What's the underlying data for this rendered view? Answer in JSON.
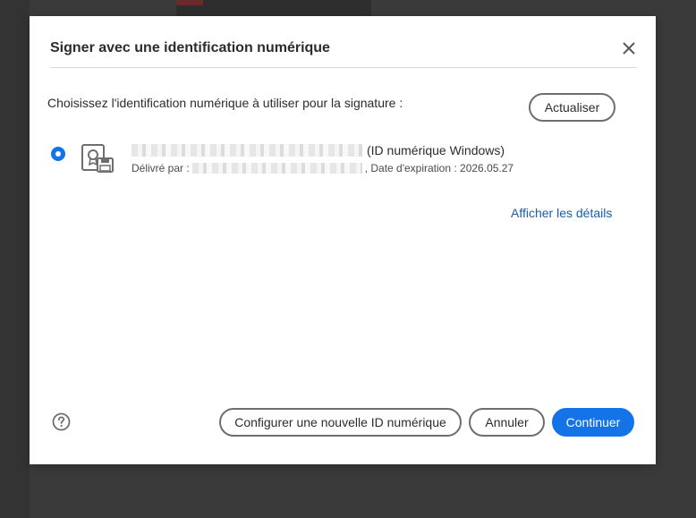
{
  "dialog": {
    "title": "Signer avec une identification numérique",
    "close_icon": "close-icon",
    "prompt": "Choisissez l'identification numérique à utiliser pour la signature :",
    "refresh_label": "Actualiser",
    "digital_id": {
      "selected": true,
      "icon": "certificate-icon",
      "type_label": "(ID numérique Windows)",
      "issued_by_label": "Délivré par :",
      "expiration_text": ", Date d'expiration : 2026.05.27"
    },
    "details_link": "Afficher les détails",
    "help_icon": "help-icon",
    "buttons": {
      "configure": "Configurer une nouvelle ID numérique",
      "cancel": "Annuler",
      "continue": "Continuer"
    }
  },
  "colors": {
    "accent": "#1473e6",
    "link": "#1c5ea8",
    "backdrop": "#3a3a3a"
  }
}
